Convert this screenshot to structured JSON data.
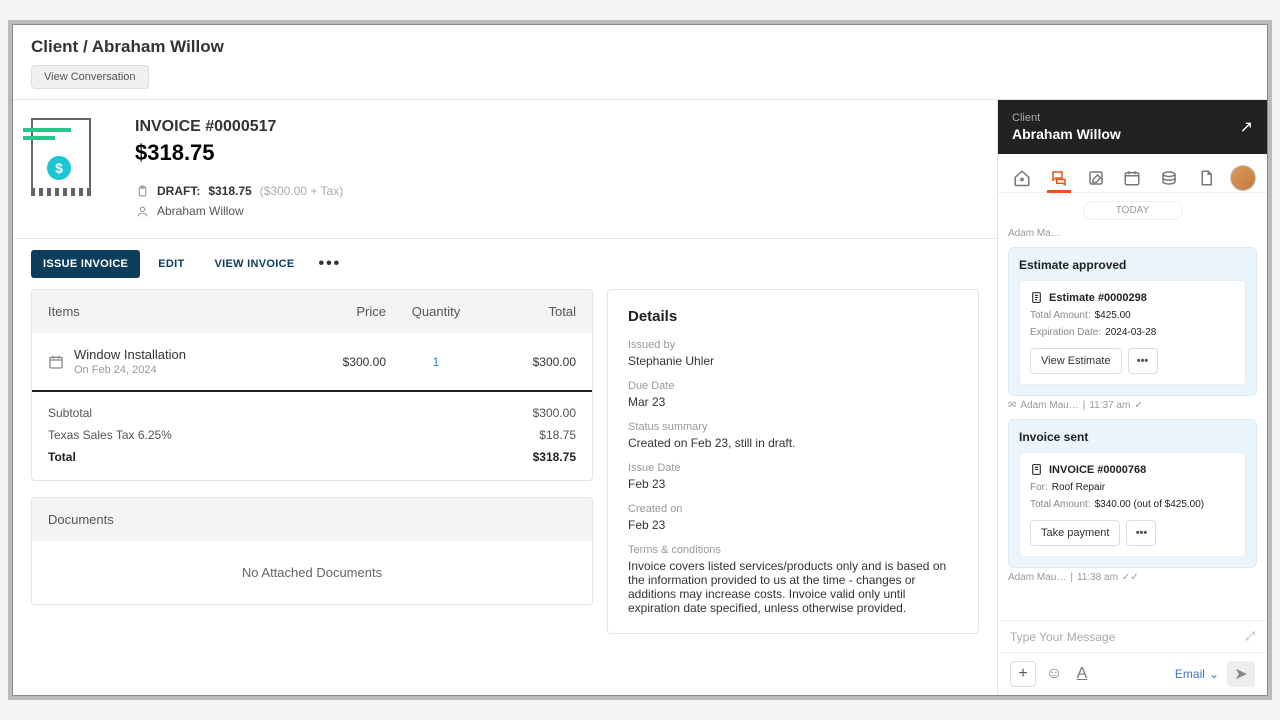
{
  "breadcrumb": "Client / Abraham Willow",
  "view_conversation": "View Conversation",
  "invoice": {
    "title": "INVOICE #0000517",
    "amount": "$318.75",
    "status_label": "DRAFT:",
    "status_amount": "$318.75",
    "status_tax": "($300.00 + Tax)",
    "client": "Abraham Willow"
  },
  "actions": {
    "issue": "ISSUE INVOICE",
    "edit": "EDIT",
    "view": "VIEW INVOICE"
  },
  "items_header": {
    "items": "Items",
    "price": "Price",
    "qty": "Quantity",
    "total": "Total"
  },
  "item": {
    "name": "Window Installation",
    "sub": "On Feb 24, 2024",
    "price": "$300.00",
    "qty": "1",
    "total": "$300.00"
  },
  "totals": {
    "subtotal_l": "Subtotal",
    "subtotal_v": "$300.00",
    "tax_l": "Texas Sales Tax 6.25%",
    "tax_v": "$18.75",
    "total_l": "Total",
    "total_v": "$318.75"
  },
  "documents": {
    "title": "Documents",
    "empty": "No Attached Documents"
  },
  "details": {
    "title": "Details",
    "issued_by_l": "Issued by",
    "issued_by_v": "Stephanie Uhler",
    "due_l": "Due Date",
    "due_v": "Mar 23",
    "status_l": "Status summary",
    "status_v": "Created on Feb 23, still in draft.",
    "issue_l": "Issue Date",
    "issue_v": "Feb 23",
    "created_l": "Created on",
    "created_v": "Feb 23",
    "terms_l": "Terms & conditions",
    "terms_v": "Invoice covers listed services/products only and is based on the information provided to us at the time - changes or additions may increase costs. Invoice valid only until expiration date specified, unless otherwise provided."
  },
  "side": {
    "label": "Client",
    "name": "Abraham Willow",
    "today": "TODAY",
    "adam": "Adam Ma…",
    "estimate": {
      "title": "Estimate approved",
      "num": "Estimate #0000298",
      "total_l": "Total Amount:",
      "total_v": "$425.00",
      "exp_l": "Expiration Date:",
      "exp_v": "2024-03-28",
      "view": "View Estimate",
      "meta_name": "Adam Mau…",
      "meta_time": "11:37 am"
    },
    "invoice": {
      "title": "Invoice sent",
      "num": "INVOICE #0000768",
      "for_l": "For:",
      "for_v": "Roof Repair",
      "total_l": "Total Amount:",
      "total_v": "$340.00 (out of $425.00)",
      "take": "Take payment",
      "meta_name": "Adam Mau…",
      "meta_time": "11:38 am"
    },
    "compose_placeholder": "Type Your Message",
    "channel": "Email"
  }
}
